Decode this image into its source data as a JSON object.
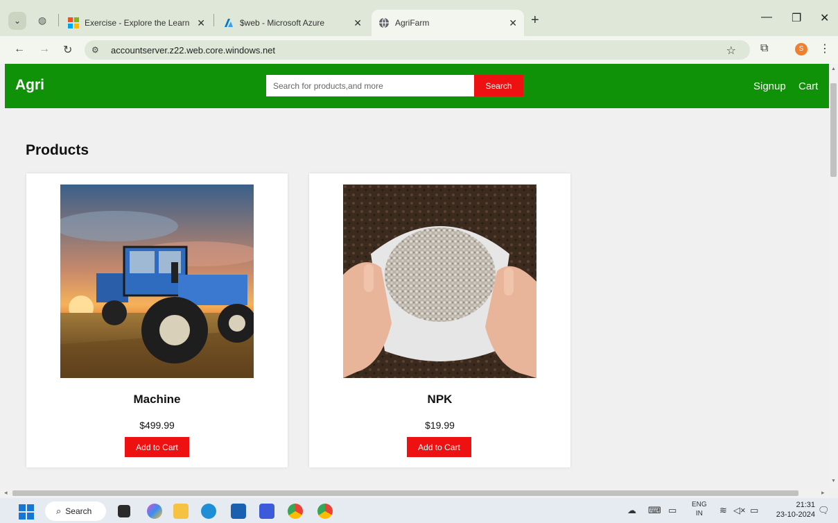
{
  "browser": {
    "tabs": [
      {
        "label": "Exercise - Explore the Learn sandbox",
        "active": false,
        "icon": "microsoft-logo-icon"
      },
      {
        "label": "$web - Microsoft Azure",
        "active": false,
        "icon": "azure-logo-icon"
      },
      {
        "label": "AgriFarm",
        "active": true,
        "icon": "globe-icon"
      }
    ],
    "url": "accountserver.z22.web.core.windows.net",
    "profile_initial": "S"
  },
  "site": {
    "brand": "Agri",
    "search_placeholder": "Search for products,and more",
    "search_button": "Search",
    "nav": {
      "signup": "Signup",
      "cart": "Cart"
    },
    "section_title": "Products",
    "products": [
      {
        "name": "Machine",
        "price": "$499.99",
        "button": "Add to Cart",
        "image": "blue tractor in field at sunset"
      },
      {
        "name": "NPK",
        "price": "$19.99",
        "button": "Add to Cart",
        "image": "hands holding open sack of fertilizer granules"
      }
    ],
    "colors": {
      "header": "#0f9108",
      "accent": "#ee1111"
    }
  },
  "taskbar": {
    "search_label": "Search",
    "language": "ENG",
    "region": "IN",
    "time": "21:31",
    "date": "23-10-2024"
  }
}
